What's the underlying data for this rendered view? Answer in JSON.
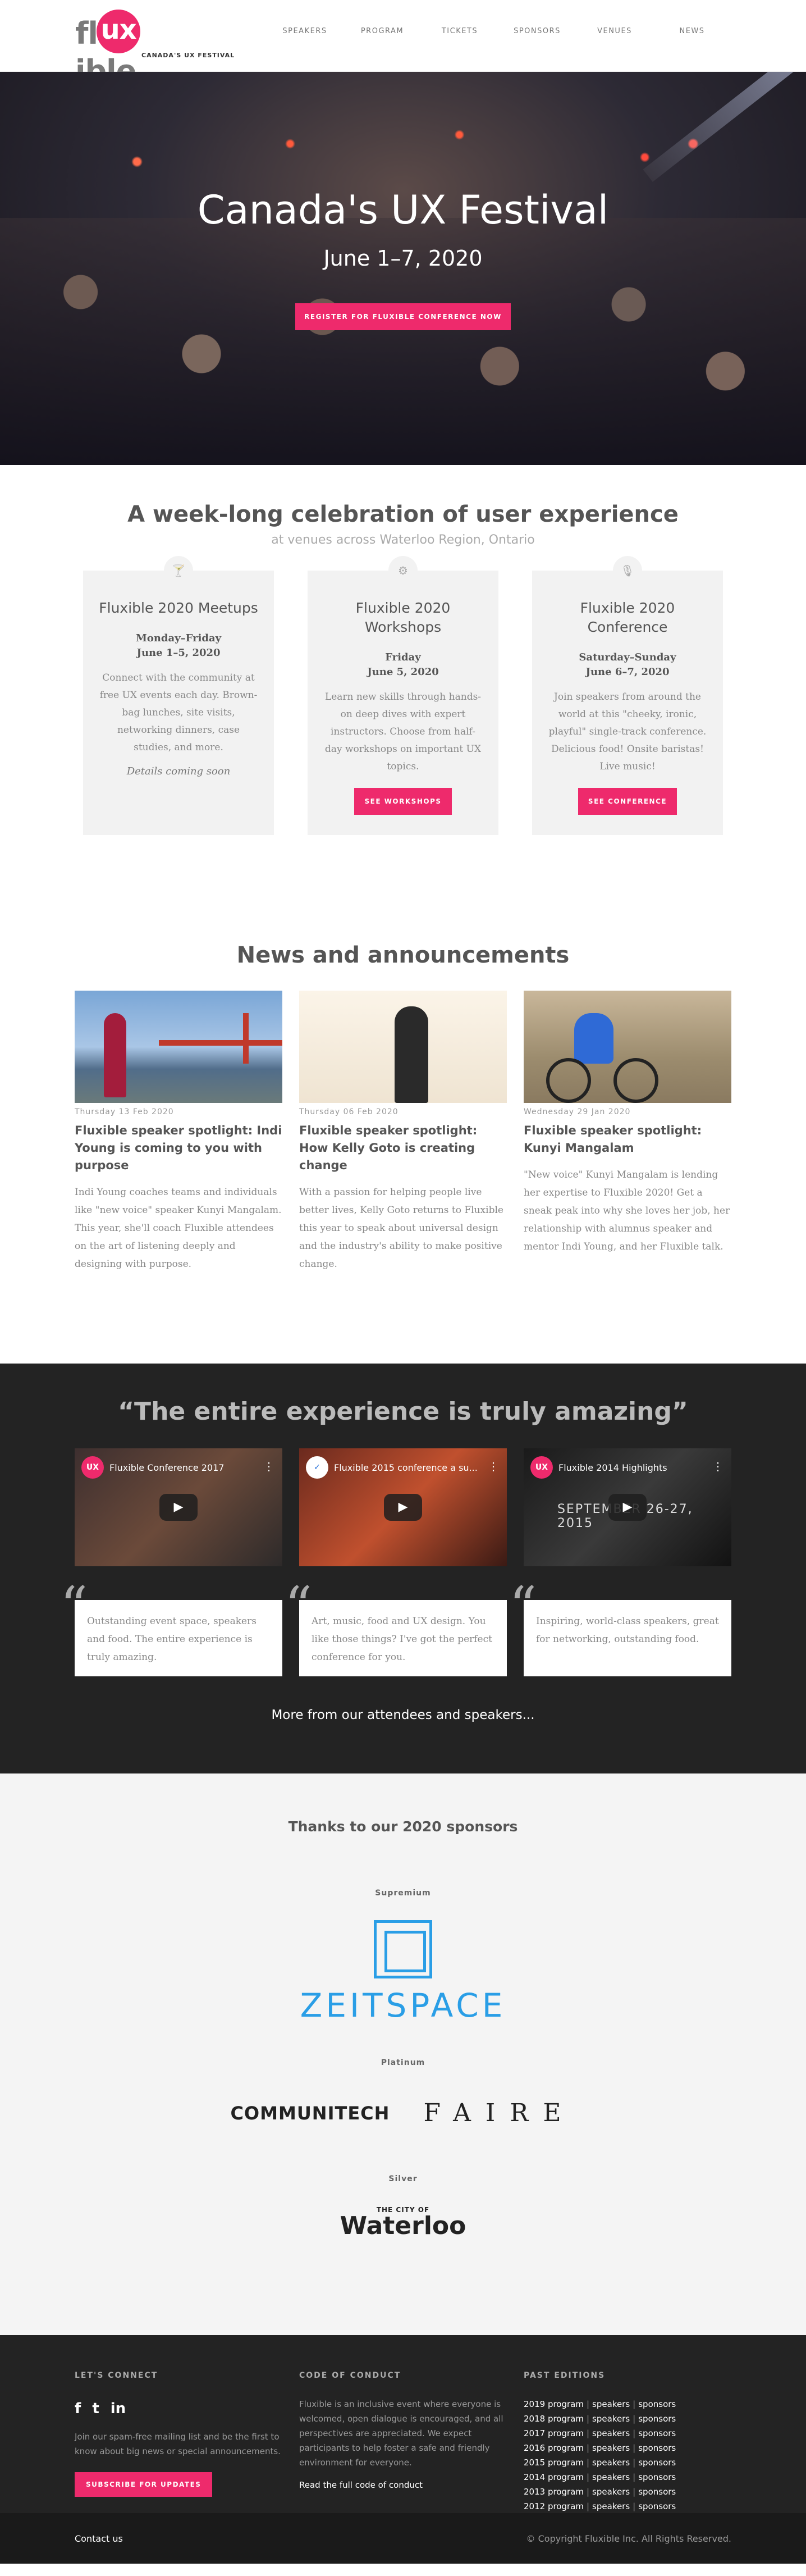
{
  "colors": {
    "accent": "#ee2a6c",
    "dark": "#232323",
    "light": "#f2f2f2"
  },
  "logo": {
    "pre": "fl",
    "mid": "ux",
    "post": "ible",
    "tagline": "CANADA'S UX FESTIVAL"
  },
  "nav": [
    "SPEAKERS",
    "PROGRAM",
    "TICKETS",
    "SPONSORS",
    "VENUES",
    "NEWS"
  ],
  "hero": {
    "title": "Canada's UX Festival",
    "date": "June 1–7, 2020",
    "button": "REGISTER FOR FLUXIBLE CONFERENCE NOW"
  },
  "events": {
    "title": "A week-long celebration of user experience",
    "subtitle": "at venues across Waterloo Region, Ontario",
    "cards": [
      {
        "icon": "cocktail-icon",
        "title": "Fluxible 2020 Meetups",
        "when1": "Monday–Friday",
        "when2": "June 1–5, 2020",
        "desc": "Connect with the community at free UX events each day. Brown-bag lunches, site visits, networking dinners, case studies, and more.",
        "note": "Details coming soon"
      },
      {
        "icon": "gear-icon",
        "title": "Fluxible 2020 Workshops",
        "when1": "Friday",
        "when2": "June 5, 2020",
        "desc": "Learn new skills through hands-on deep dives with expert instructors. Choose from half-day workshops on important UX topics.",
        "button": "SEE WORKSHOPS"
      },
      {
        "icon": "microphone-icon",
        "title": "Fluxible 2020 Conference",
        "when1": "Saturday–Sunday",
        "when2": "June 6–7, 2020",
        "desc": "Join speakers from around the world at this \"cheeky, ironic, playful\" single-track conference. Delicious food! Onsite baristas! Live music!",
        "button": "SEE CONFERENCE"
      }
    ]
  },
  "news": {
    "title": "News and announcements",
    "items": [
      {
        "date": "Thursday 13 Feb 2020",
        "title": "Fluxible speaker spotlight: Indi Young is coming to you with purpose",
        "body": "Indi Young coaches teams and individuals like \"new voice\" speaker Kunyi Mangalam. This year, she'll coach Fluxible attendees on the art of listening deeply and designing with purpose."
      },
      {
        "date": "Thursday 06 Feb 2020",
        "title": "Fluxible speaker spotlight: How Kelly Goto is creating change",
        "body": "With a passion for helping people live better lives, Kelly Goto returns to Fluxible this year to speak about universal design and the industry's ability to make positive change."
      },
      {
        "date": "Wednesday 29 Jan 2020",
        "title": "Fluxible speaker spotlight: Kunyi Mangalam",
        "body": "\"New voice\" Kunyi Mangalam is lending her expertise to Fluxible 2020! Get a sneak peak into why she loves her job, her relationship with alumnus speaker and mentor Indi Young, and her Fluxible talk."
      }
    ]
  },
  "testimonials": {
    "title": "“The entire experience is truly amazing”",
    "videos": [
      {
        "avatar": "UX",
        "title": "Fluxible Conference 2017"
      },
      {
        "avatar": "✓",
        "title": "Fluxible 2015 conference a su..."
      },
      {
        "avatar": "UX",
        "title": "Fluxible 2014 Highlights",
        "extra": "SEPTEMBER 26-27, 2015"
      }
    ],
    "quotes": [
      "Outstanding event space, speakers and food. The entire experience is truly amazing.",
      "Art, music, food and UX design. You like those things? I've got the perfect conference for you.",
      "Inspiring, world-class speakers, great for networking, outstanding food."
    ],
    "more": "More from our attendees and speakers..."
  },
  "sponsors": {
    "title": "Thanks to our 2020 sponsors",
    "tier1": "Supremium",
    "zeit": "ZEITSPACE",
    "tier2": "Platinum",
    "communitech": "COMMUNITECH",
    "faire": "FAIRE",
    "tier3": "Silver",
    "waterloo_small": "THE CITY OF",
    "waterloo_big": "Waterloo"
  },
  "footer": {
    "connect_head": "LET'S CONNECT",
    "social": [
      "f",
      "t",
      "in"
    ],
    "connect_text": "Join our spam-free mailing list and be the first to know about big news or special announcements.",
    "subscribe": "SUBSCRIBE FOR UPDATES",
    "coc_head": "CODE OF CONDUCT",
    "coc_text": "Fluxible is an inclusive event where everyone is welcomed, open dialogue is encouraged, and all perspectives are appreciated. We expect participants to help foster a safe and friendly environment for everyone.",
    "coc_link": "Read the full code of conduct",
    "past_head": "PAST EDITIONS",
    "editions": [
      {
        "program": "2019 program",
        "speakers": "speakers",
        "sponsors": "sponsors"
      },
      {
        "program": "2018 program",
        "speakers": "speakers",
        "sponsors": "sponsors"
      },
      {
        "program": "2017 program",
        "speakers": "speakers",
        "sponsors": "sponsors"
      },
      {
        "program": "2016 program",
        "speakers": "speakers",
        "sponsors": "sponsors"
      },
      {
        "program": "2015 program",
        "speakers": "speakers",
        "sponsors": "sponsors"
      },
      {
        "program": "2014 program",
        "speakers": "speakers",
        "sponsors": "sponsors"
      },
      {
        "program": "2013 program",
        "speakers": "speakers",
        "sponsors": "sponsors"
      },
      {
        "program": "2012 program",
        "speakers": "speakers",
        "sponsors": "sponsors"
      }
    ],
    "contact": "Contact us",
    "copyright": "© Copyright Fluxible Inc. All Rights Reserved."
  }
}
